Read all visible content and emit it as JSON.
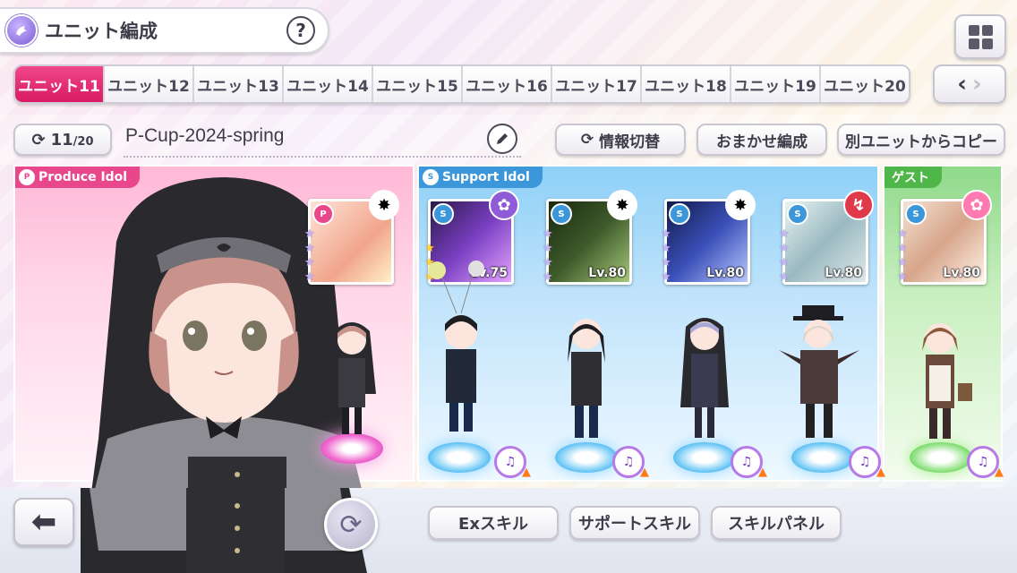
{
  "header": {
    "title": "ユニット編成",
    "help": "?"
  },
  "tabs": [
    "ユニット11",
    "ユニット12",
    "ユニット13",
    "ユニット14",
    "ユニット15",
    "ユニット16",
    "ユニット17",
    "ユニット18",
    "ユニット19",
    "ユニット20"
  ],
  "active_tab": "ユニット11",
  "unit": {
    "count": "11",
    "total": "/20",
    "name": "P-Cup-2024-spring"
  },
  "actions": {
    "info_toggle": "情報切替",
    "auto": "おまかせ編成",
    "copy": "別ユニットからコピー"
  },
  "panels": {
    "produce": "Produce Idol",
    "support": "Support Idol",
    "guest": "ゲスト"
  },
  "cards": [
    {
      "slot": "produce",
      "type": "P",
      "level": "",
      "stars_gold": 0,
      "stars": 4,
      "color": "#f1a58c"
    },
    {
      "slot": "support-1",
      "type": "S",
      "level": "Lv.75",
      "stars_gold": 3,
      "stars": 3,
      "color": "#7a3fc2"
    },
    {
      "slot": "support-2",
      "type": "S",
      "level": "Lv.80",
      "stars_gold": 0,
      "stars": 4,
      "color": "#3e5a2a"
    },
    {
      "slot": "support-3",
      "type": "S",
      "level": "Lv.80",
      "stars_gold": 0,
      "stars": 4,
      "color": "#3a4fb8"
    },
    {
      "slot": "support-4",
      "type": "S",
      "level": "Lv.80",
      "stars_gold": 0,
      "stars": 4,
      "color": "#9ab9c0"
    },
    {
      "slot": "guest",
      "type": "S",
      "level": "Lv.80",
      "stars_gold": 0,
      "stars": 4,
      "color": "#d7a58a"
    }
  ],
  "upgrade_label": "♫",
  "bottom": {
    "ex_skill": "Exスキル",
    "support_skill": "サポートスキル",
    "skill_panel": "スキルパネル"
  },
  "colors": {
    "active_tab": "#d81b63",
    "produce": "#e9478c",
    "support": "#3b97d9",
    "guest": "#4fb64a"
  }
}
